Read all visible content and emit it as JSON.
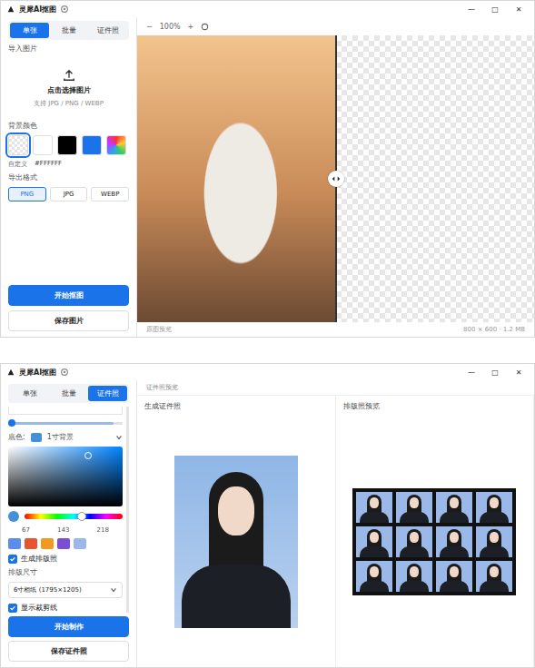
{
  "matting_window": {
    "title": "灵犀AI抠图",
    "controls": [
      "—",
      "□",
      "✕"
    ],
    "tabs": [
      {
        "label": "单张",
        "selected": true
      },
      {
        "label": "批量",
        "selected": false
      },
      {
        "label": "证件照",
        "selected": false
      }
    ],
    "import_label": "导入图片",
    "upload_text": "点击选择图片",
    "upload_hint": "支持 JPG / PNG / WEBP",
    "bg_label": "背景颜色",
    "swatches": [
      {
        "kind": "transparent",
        "selected": true
      },
      {
        "kind": "solid",
        "color": "#ffffff",
        "selected": false
      },
      {
        "kind": "solid",
        "color": "#000000",
        "selected": false
      },
      {
        "kind": "solid",
        "color": "#1a73e8",
        "selected": false
      },
      {
        "kind": "gradient",
        "selected": false
      }
    ],
    "custom_label": "自定义",
    "custom_value": "#FFFFFF",
    "format_label": "导出格式",
    "formats": [
      {
        "label": "PNG",
        "selected": true
      },
      {
        "label": "JPG",
        "selected": false
      },
      {
        "label": "WEBP",
        "selected": false
      }
    ],
    "start_button": "开始抠图",
    "save_button": "保存图片",
    "toolbar": {
      "zoom_out": "−",
      "zoom": "100%",
      "zoom_in": "+"
    },
    "compare_level": 0.5,
    "status_left": "原图预览",
    "status_right": "800 × 600 · 1.2 MB"
  },
  "id_photo_window": {
    "title": "灵犀AI抠图",
    "controls": [
      "—",
      "□",
      "✕"
    ],
    "tabs": [
      {
        "label": "单张",
        "selected": false
      },
      {
        "label": "批量",
        "selected": false
      },
      {
        "label": "证件照",
        "selected": true
      }
    ],
    "slider_level": 0.92,
    "bg_label": "底色:",
    "bg_color": "#438fda",
    "bg_select": "1寸背景",
    "picker": {
      "hue_level": 0.58,
      "saturation": 0.7,
      "value": 0.85
    },
    "rgb": [
      "67",
      "143",
      "218"
    ],
    "presets": [
      {
        "color": "#5b8def"
      },
      {
        "color": "#e8542f"
      },
      {
        "color": "#f29a1f"
      },
      {
        "color": "#7a4fd6"
      },
      {
        "color": "#9ab8e8"
      }
    ],
    "layout_checkbox": {
      "label": "生成排版照",
      "checked": true
    },
    "size_label": "排版尺寸",
    "size_select": "6寸相纸 (1795×1205)",
    "cropline_checkbox": {
      "label": "显示裁剪线",
      "checked": true
    },
    "start_button": "开始制作",
    "save_button": "保存证件照",
    "header": "证件照预览",
    "preview_title": "生成证件照",
    "sheet_title": "排版照预览",
    "copies": 12
  }
}
